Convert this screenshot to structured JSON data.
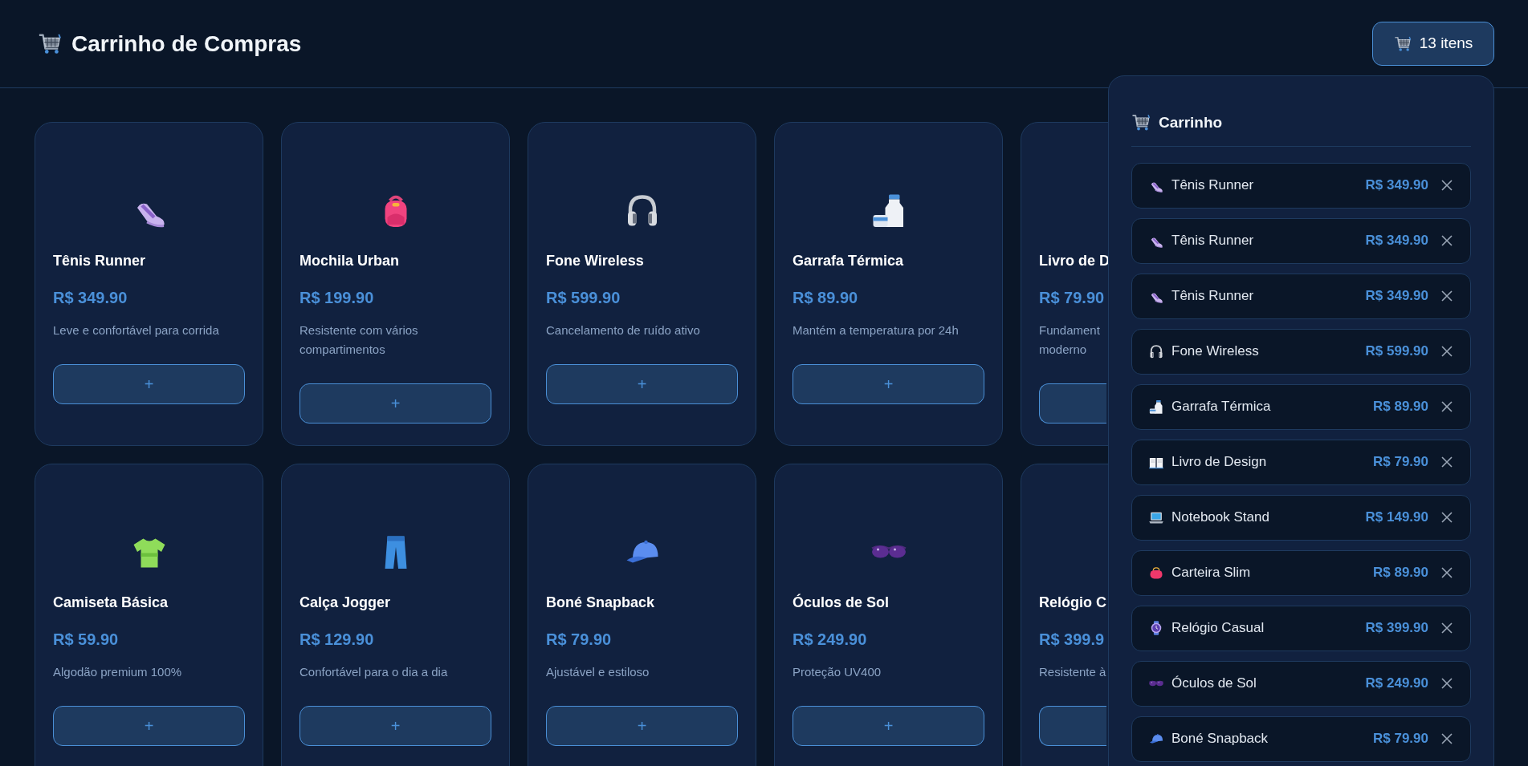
{
  "header": {
    "title": "Carrinho de Compras",
    "cart_button": "13 itens"
  },
  "products": [
    {
      "kind": "shoe",
      "name": "Tênis Runner",
      "price": "R$ 349.90",
      "description": "Leve e confortável para corrida",
      "button": "+"
    },
    {
      "kind": "backpack",
      "name": "Mochila Urban",
      "price": "R$ 199.90",
      "description": "Resistente com vários compartimentos",
      "button": "+"
    },
    {
      "kind": "headphones",
      "name": "Fone Wireless",
      "price": "R$ 599.90",
      "description": "Cancelamento de ruído ativo",
      "button": "+"
    },
    {
      "kind": "bottle",
      "name": "Garrafa Térmica",
      "price": "R$ 89.90",
      "description": "Mantém a temperatura por 24h",
      "button": "+"
    },
    {
      "name": "Livro de D",
      "price": "R$ 79.90",
      "description": "Fundament\nmoderno"
    },
    {
      "kind": "tshirt",
      "name": "Camiseta Básica",
      "price": "R$ 59.90",
      "description": "Algodão premium 100%",
      "button": "+"
    },
    {
      "kind": "jeans",
      "name": "Calça Jogger",
      "price": "R$ 129.90",
      "description": "Confortável para o dia a dia",
      "button": "+"
    },
    {
      "kind": "cap",
      "name": "Boné Snapback",
      "price": "R$ 79.90",
      "description": "Ajustável e estiloso",
      "button": "+"
    },
    {
      "kind": "sunglasses",
      "name": "Óculos de Sol",
      "price": "R$ 249.90",
      "description": "Proteção UV400",
      "button": "+"
    },
    {
      "name": "Relógio C",
      "price": "R$ 399.9",
      "description": "Resistente à"
    }
  ],
  "cart": {
    "title": "Carrinho",
    "items": [
      {
        "kind": "shoe",
        "name": "Tênis Runner",
        "price": "R$ 349.90"
      },
      {
        "kind": "shoe",
        "name": "Tênis Runner",
        "price": "R$ 349.90"
      },
      {
        "kind": "shoe",
        "name": "Tênis Runner",
        "price": "R$ 349.90"
      },
      {
        "kind": "headphones",
        "name": "Fone Wireless",
        "price": "R$ 599.90"
      },
      {
        "kind": "bottle",
        "name": "Garrafa Térmica",
        "price": "R$ 89.90"
      },
      {
        "kind": "book",
        "name": "Livro de Design",
        "price": "R$ 79.90"
      },
      {
        "kind": "laptop",
        "name": "Notebook Stand",
        "price": "R$ 149.90"
      },
      {
        "kind": "purse",
        "name": "Carteira Slim",
        "price": "R$ 89.90"
      },
      {
        "kind": "watch",
        "name": "Relógio Casual",
        "price": "R$ 399.90"
      },
      {
        "kind": "sunglasses",
        "name": "Óculos de Sol",
        "price": "R$ 249.90"
      },
      {
        "kind": "cap",
        "name": "Boné Snapback",
        "price": "R$ 79.90"
      }
    ]
  }
}
